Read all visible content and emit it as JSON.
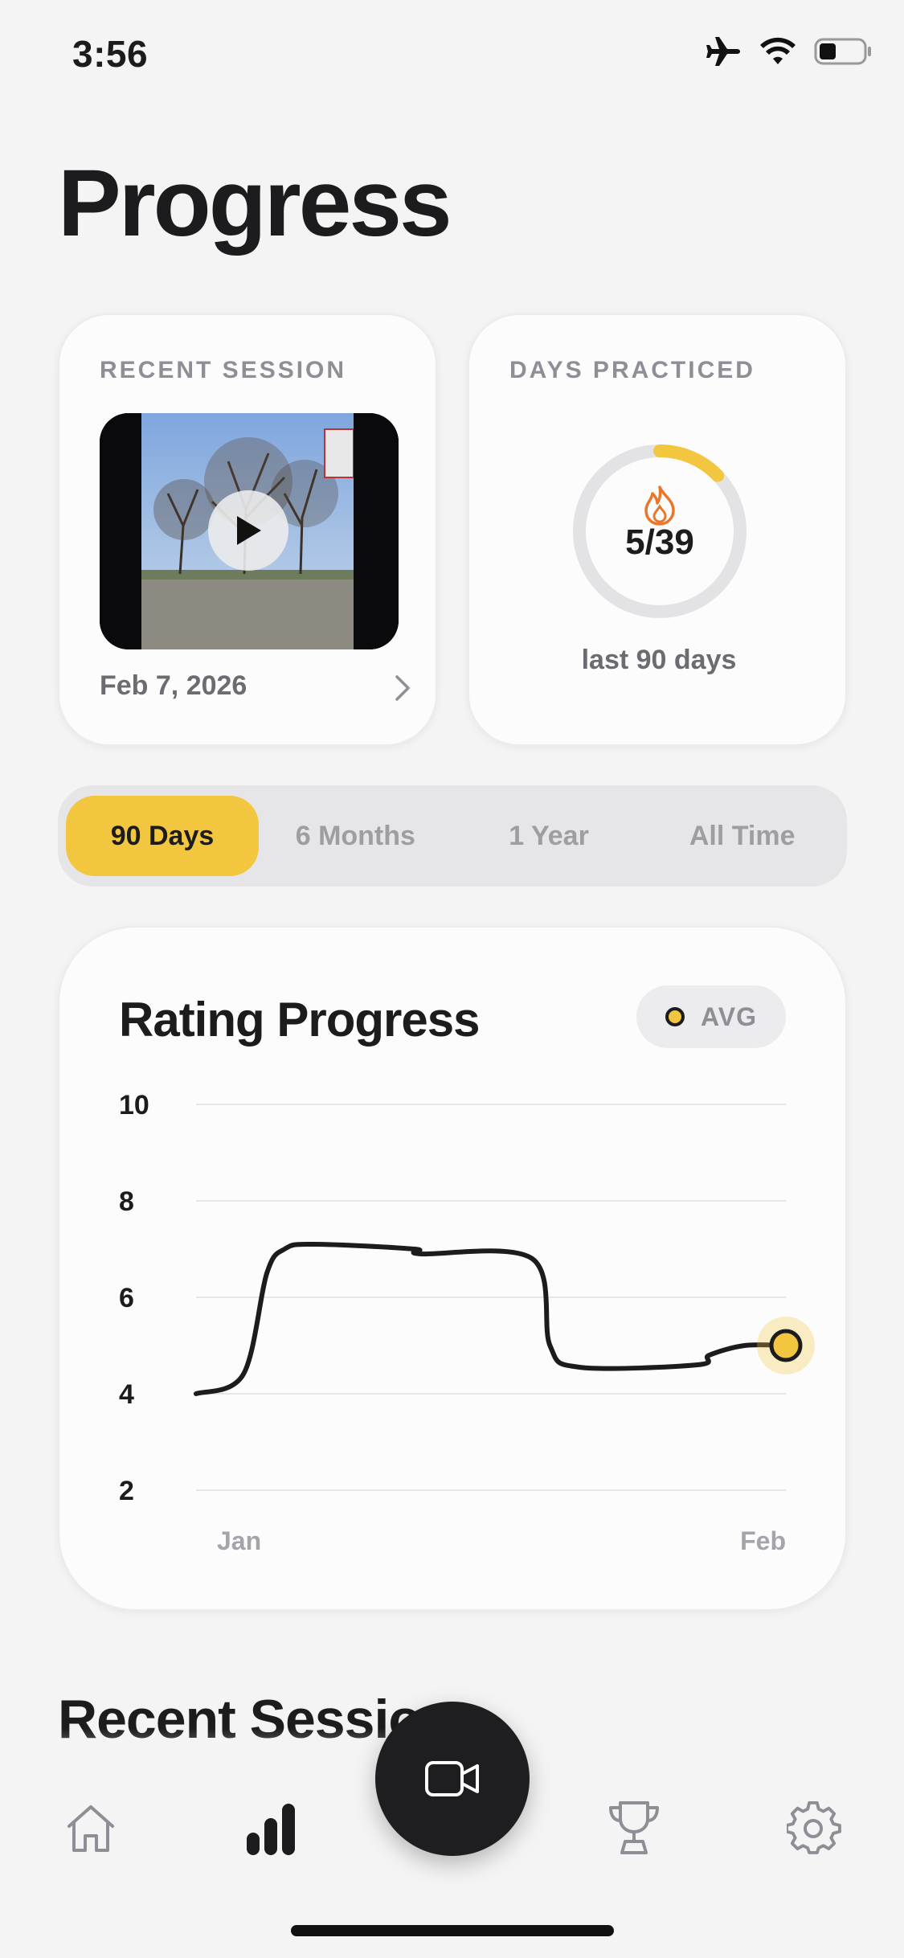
{
  "status_bar": {
    "time": "3:56",
    "icons": [
      "airplane-icon",
      "wifi-icon",
      "battery-icon"
    ]
  },
  "page": {
    "title": "Progress"
  },
  "recent_session": {
    "label": "RECENT SESSION",
    "date": "Feb 7, 2026",
    "icons": [
      "play-icon",
      "chevron-right-icon"
    ]
  },
  "days_practiced": {
    "label": "DAYS PRACTICED",
    "count": "5/39",
    "progress": 0.128,
    "caption": "last 90 days",
    "icon": "flame-icon"
  },
  "range_tabs": {
    "selected": "90 Days",
    "items": [
      "90 Days",
      "6 Months",
      "1 Year",
      "All Time"
    ]
  },
  "rating_chart": {
    "title": "Rating Progress",
    "legend_label": "AVG"
  },
  "chart_data": {
    "type": "line",
    "title": "Rating Progress",
    "xlabel": "",
    "ylabel": "",
    "x_tick_labels": [
      "Jan",
      "Feb"
    ],
    "y_ticks": [
      10,
      8,
      6,
      4,
      2
    ],
    "ylim": [
      2,
      10
    ],
    "series": [
      {
        "name": "AVG",
        "color": "#1c1c1e",
        "marker_color": "#f3c63f",
        "x": [
          0.0,
          0.08,
          0.12,
          0.15,
          0.2,
          0.37,
          0.38,
          0.57,
          0.6,
          0.65,
          0.85,
          0.87,
          0.93,
          1.0
        ],
        "y": [
          4.0,
          4.4,
          6.5,
          7.0,
          7.1,
          7.0,
          6.9,
          6.8,
          5.0,
          4.55,
          4.6,
          4.8,
          5.0,
          5.0
        ]
      }
    ],
    "grid": true,
    "legend": "top-right"
  },
  "recent_sessions": {
    "title": "Recent Sessions"
  },
  "tab_bar": {
    "items": [
      "home-icon",
      "stats-icon",
      "video-camera-icon",
      "trophy-icon",
      "settings-icon"
    ],
    "active": "stats-icon"
  },
  "colors": {
    "accent": "#f3c63f",
    "flame": "#e8772e",
    "text_primary": "#1c1c1e",
    "text_secondary": "#8e8e96"
  }
}
